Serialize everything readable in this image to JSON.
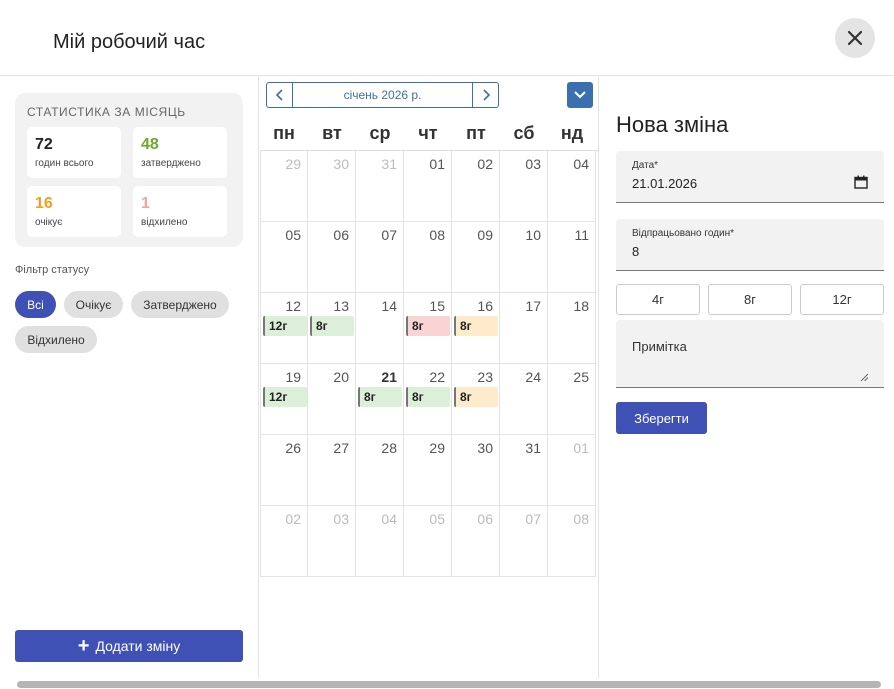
{
  "header": {
    "title": "Мій робочий час"
  },
  "stats": {
    "title": "СТАТИСТИКА ЗА МІСЯЦЬ",
    "items": [
      {
        "value": "72",
        "label": "годин всього",
        "color": "#222222"
      },
      {
        "value": "48",
        "label": "затверджено",
        "color": "#6aaa2a"
      },
      {
        "value": "16",
        "label": "очікує",
        "color": "#f0a01e"
      },
      {
        "value": "1",
        "label": "відхилено",
        "color": "#f4a3a3"
      }
    ]
  },
  "filter": {
    "label": "Фільтр статусу",
    "chips": [
      {
        "label": "Всі",
        "active": true
      },
      {
        "label": "Очікує",
        "active": false
      },
      {
        "label": "Затверджено",
        "active": false
      },
      {
        "label": "Відхилено",
        "active": false
      }
    ]
  },
  "add_button": {
    "icon": "plus-icon",
    "label": "Додати зміну"
  },
  "calendar": {
    "month_label": "січень 2026 р.",
    "weekdays": [
      "пн",
      "вт",
      "ср",
      "чт",
      "пт",
      "сб",
      "нд"
    ],
    "weeks": [
      [
        {
          "d": "29",
          "other": true
        },
        {
          "d": "30",
          "other": true
        },
        {
          "d": "31",
          "other": true
        },
        {
          "d": "01"
        },
        {
          "d": "02"
        },
        {
          "d": "03"
        },
        {
          "d": "04"
        }
      ],
      [
        {
          "d": "05"
        },
        {
          "d": "06"
        },
        {
          "d": "07"
        },
        {
          "d": "08"
        },
        {
          "d": "09"
        },
        {
          "d": "10"
        },
        {
          "d": "11"
        }
      ],
      [
        {
          "d": "12",
          "ev": "12г",
          "st": "approved"
        },
        {
          "d": "13",
          "ev": "8г",
          "st": "approved"
        },
        {
          "d": "14"
        },
        {
          "d": "15",
          "ev": "8г",
          "st": "rejected"
        },
        {
          "d": "16",
          "ev": "8г",
          "st": "pending"
        },
        {
          "d": "17"
        },
        {
          "d": "18"
        }
      ],
      [
        {
          "d": "19",
          "ev": "12г",
          "st": "approved"
        },
        {
          "d": "20"
        },
        {
          "d": "21",
          "today": true,
          "ev": "8г",
          "st": "approved"
        },
        {
          "d": "22",
          "ev": "8г",
          "st": "approved"
        },
        {
          "d": "23",
          "ev": "8г",
          "st": "pending"
        },
        {
          "d": "24"
        },
        {
          "d": "25"
        }
      ],
      [
        {
          "d": "26"
        },
        {
          "d": "27"
        },
        {
          "d": "28"
        },
        {
          "d": "29"
        },
        {
          "d": "30"
        },
        {
          "d": "31"
        },
        {
          "d": "01",
          "other": true
        }
      ],
      [
        {
          "d": "02",
          "other": true
        },
        {
          "d": "03",
          "other": true
        },
        {
          "d": "04",
          "other": true
        },
        {
          "d": "05",
          "other": true
        },
        {
          "d": "06",
          "other": true
        },
        {
          "d": "07",
          "other": true
        },
        {
          "d": "08",
          "other": true
        }
      ]
    ]
  },
  "form": {
    "title": "Нова зміна",
    "date_label": "Дата*",
    "date_value": "21.01.2026",
    "hours_label": "Відпрацьовано годин*",
    "hours_value": "8",
    "quick_options": [
      "4г",
      "8г",
      "12г"
    ],
    "note_placeholder": "Примітка",
    "save_label": "Зберегти"
  },
  "colors": {
    "primary": "#3f51b5",
    "calendar_accent": "#3b6fb0",
    "approved": "#dcefd8",
    "pending": "#fdebcc",
    "rejected": "#fad4d4"
  }
}
